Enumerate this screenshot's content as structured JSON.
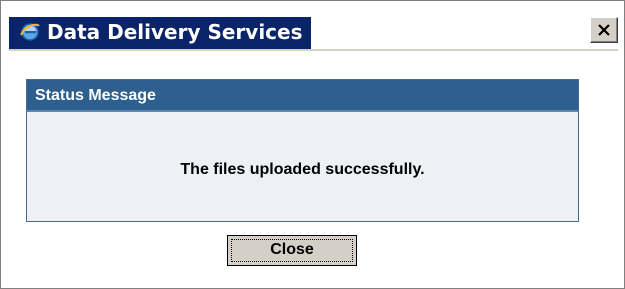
{
  "window": {
    "title": "Data Delivery Services",
    "title_icon": "internet-explorer-icon",
    "close_icon": "close-icon"
  },
  "status_box": {
    "header": "Status Message",
    "message": "The files uploaded successfully."
  },
  "actions": {
    "close_label": "Close"
  },
  "colors": {
    "title_bar": "#0a246a",
    "status_header": "#2e5f8e",
    "status_body": "#edf1f6",
    "dialog_chrome": "#d4d0c8"
  }
}
